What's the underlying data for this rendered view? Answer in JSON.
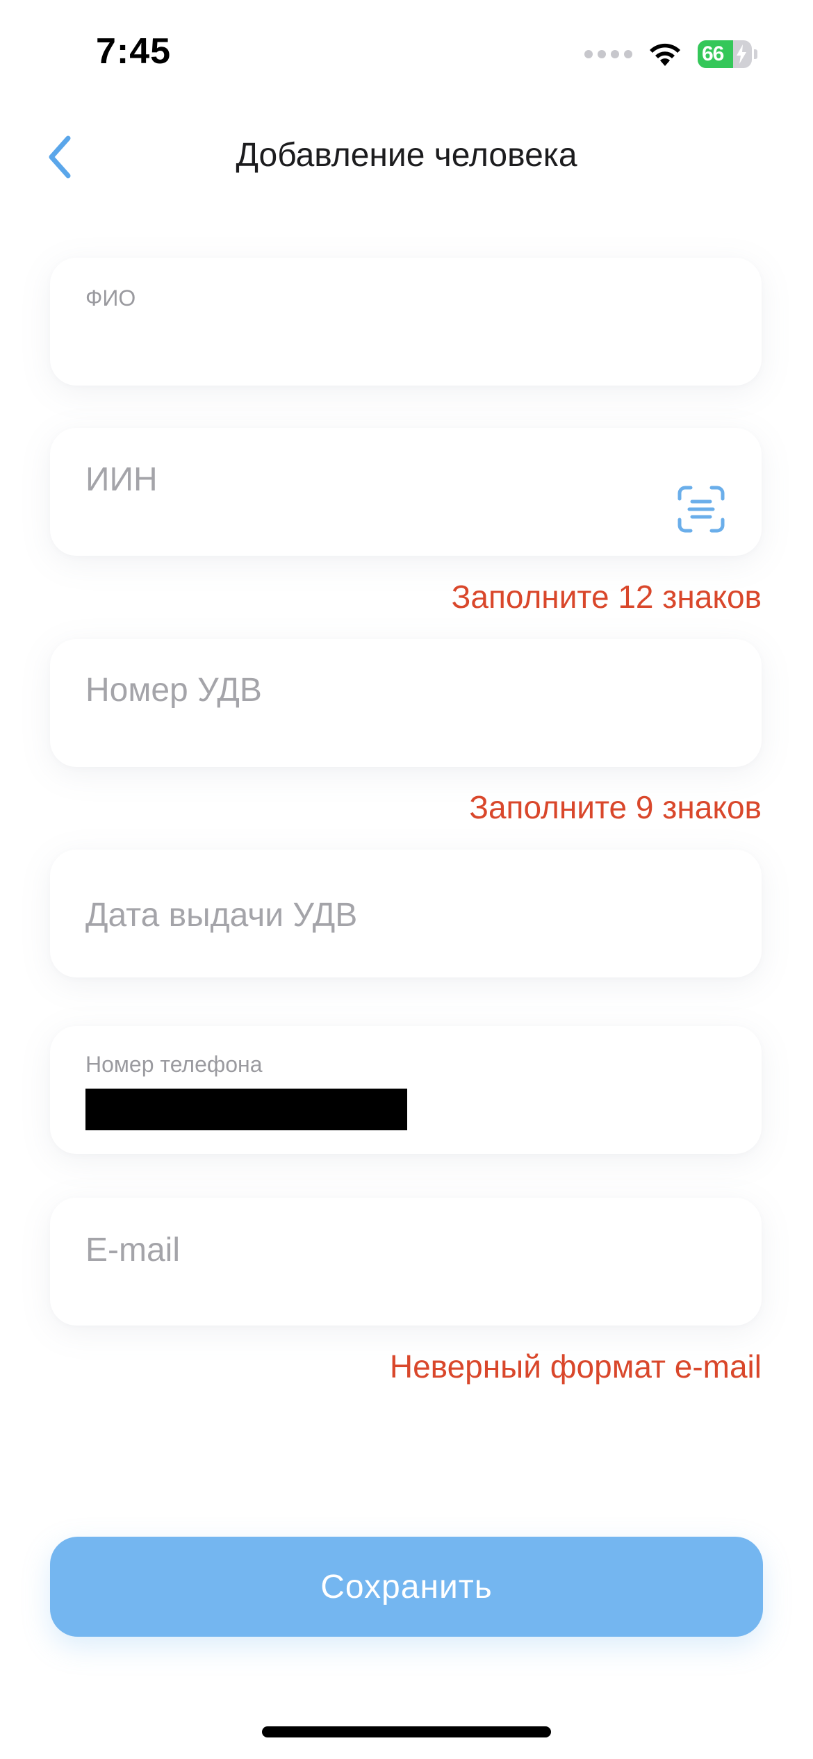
{
  "status_bar": {
    "time": "7:45",
    "battery_level": "66",
    "battery_fraction": 0.66,
    "icons": [
      "signal-dots-icon",
      "wifi-icon",
      "battery-charging-icon"
    ]
  },
  "header": {
    "title": "Добавление человека",
    "back_icon": "chevron-left-icon"
  },
  "form": {
    "full_name": {
      "label": "ФИО",
      "value": ""
    },
    "iin": {
      "placeholder": "ИИН",
      "error": "Заполните 12 знаков",
      "scan_icon": "scan-icon"
    },
    "id_number": {
      "placeholder": "Номер УДВ",
      "error": "Заполните 9 знаков"
    },
    "id_issue_date": {
      "placeholder": "Дата выдачи УДВ"
    },
    "phone": {
      "label": "Номер телефона"
    },
    "email": {
      "placeholder": "E-mail",
      "error": "Неверный формат e-mail"
    }
  },
  "actions": {
    "save_label": "Сохранить"
  },
  "colors": {
    "accent": "#74b6f0",
    "back_icon": "#5aa6ea",
    "error": "#d9472b",
    "placeholder": "#a4a4a9",
    "battery": "#34c759"
  }
}
